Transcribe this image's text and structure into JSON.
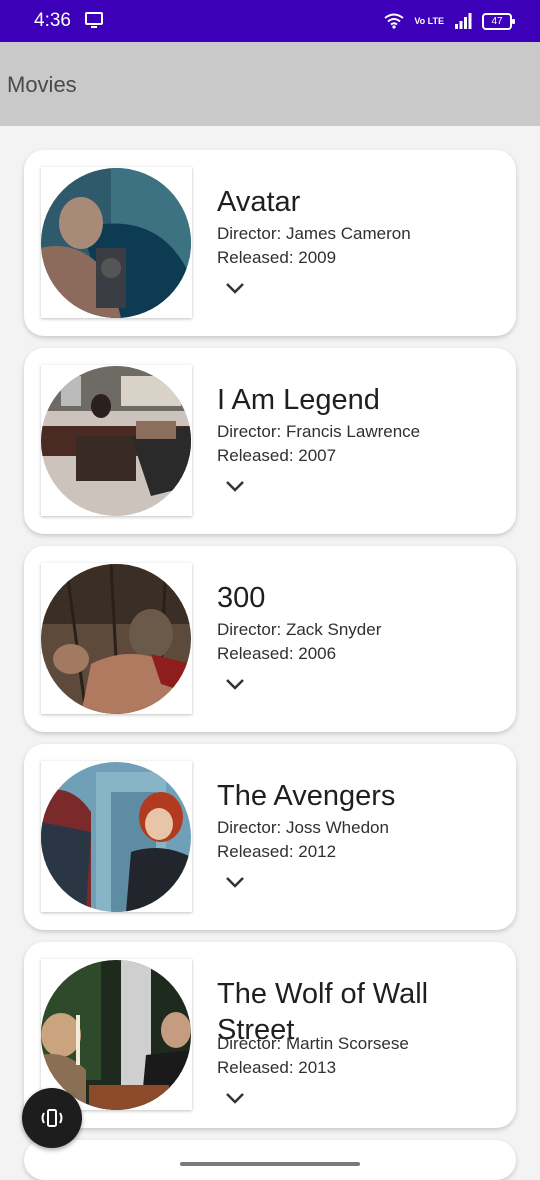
{
  "status_bar": {
    "time": "4:36",
    "network_label": "Vo LTE",
    "battery": "47"
  },
  "app_bar": {
    "title": "Movies"
  },
  "movies": [
    {
      "title": "Avatar",
      "director": "Director: James Cameron",
      "released": "Released: 2009"
    },
    {
      "title": "I Am Legend",
      "director": "Director: Francis Lawrence",
      "released": "Released: 2007"
    },
    {
      "title": "300",
      "director": "Director: Zack Snyder",
      "released": "Released: 2006"
    },
    {
      "title": "The Avengers",
      "director": "Director: Joss Whedon",
      "released": "Released: 2012"
    },
    {
      "title": "The Wolf of Wall Street",
      "director": "Director: Martin Scorsese",
      "released": "Released: 2013"
    }
  ],
  "icons": {
    "expand": "chevron-down-icon",
    "fab": "screen-rotate-icon"
  },
  "colors": {
    "status_bar": "#3b00b8",
    "app_bar": "#c9c9c9",
    "fab": "#1d1d1d"
  }
}
